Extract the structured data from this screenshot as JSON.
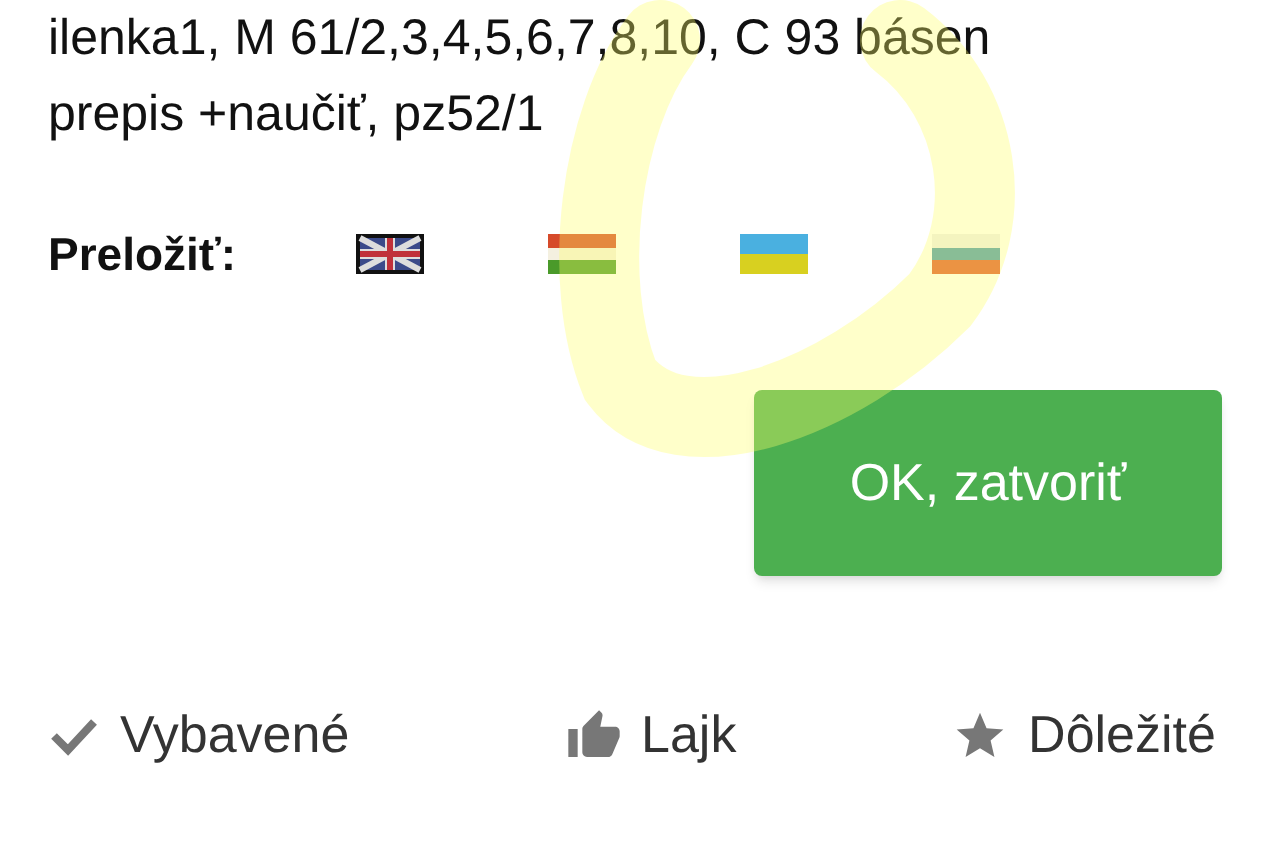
{
  "note_lines": [
    "ilenka1, M 61/2,3,4,5,6,7,8,10, C 93 básen",
    "prepis +naučiť, pz52/1"
  ],
  "translate": {
    "label": "Preložiť:",
    "flags": [
      {
        "kind": "uk"
      },
      {
        "kind": "hu"
      },
      {
        "kind": "ua"
      },
      {
        "kind": "ru"
      }
    ]
  },
  "ok_button": "OK, zatvoriť",
  "actions": [
    {
      "kind": "check",
      "label": "Vybavené"
    },
    {
      "kind": "like",
      "label": "Lajk"
    },
    {
      "kind": "star",
      "label": "Dôležité"
    }
  ]
}
